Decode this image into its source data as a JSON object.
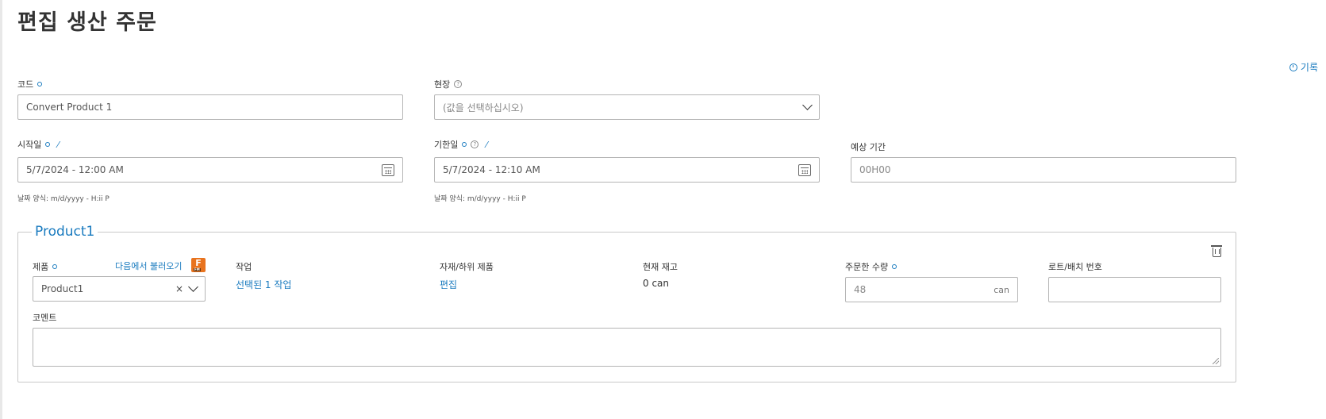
{
  "page": {
    "title": "편집 생산 주문"
  },
  "history": {
    "label": "기록"
  },
  "fields": {
    "code": {
      "label": "코드",
      "value": "Convert Product 1"
    },
    "site": {
      "label": "현장",
      "placeholder": "(값을 선택하십시오)"
    },
    "start": {
      "label": "시작일",
      "value": "5/7/2024 - 12:00 AM",
      "hint": "날짜 양식: m/d/yyyy - H:ii P"
    },
    "due": {
      "label": "기한일",
      "value": "5/7/2024 - 12:10 AM",
      "hint": "날짜 양식: m/d/yyyy - H:ii P"
    },
    "duration": {
      "label": "예상 기간",
      "placeholder": "00H00"
    }
  },
  "product_section": {
    "legend": "Product1",
    "product": {
      "label": "제품",
      "import_link": "다음에서 불러오기",
      "value": "Product1"
    },
    "operation": {
      "label": "작업",
      "value": "선택된 1 작업"
    },
    "materials": {
      "label": "자재/하위 제품",
      "value": "편집"
    },
    "stock": {
      "label": "현재 재고",
      "value": "0 can"
    },
    "ordered_qty": {
      "label": "주문한 수량",
      "value": "48",
      "unit": "can"
    },
    "lot": {
      "label": "로트/배치 번호",
      "value": ""
    },
    "comment": {
      "label": "코멘트",
      "value": ""
    }
  },
  "colors": {
    "accent": "#1a7bbf",
    "badge": "#e8731e"
  }
}
